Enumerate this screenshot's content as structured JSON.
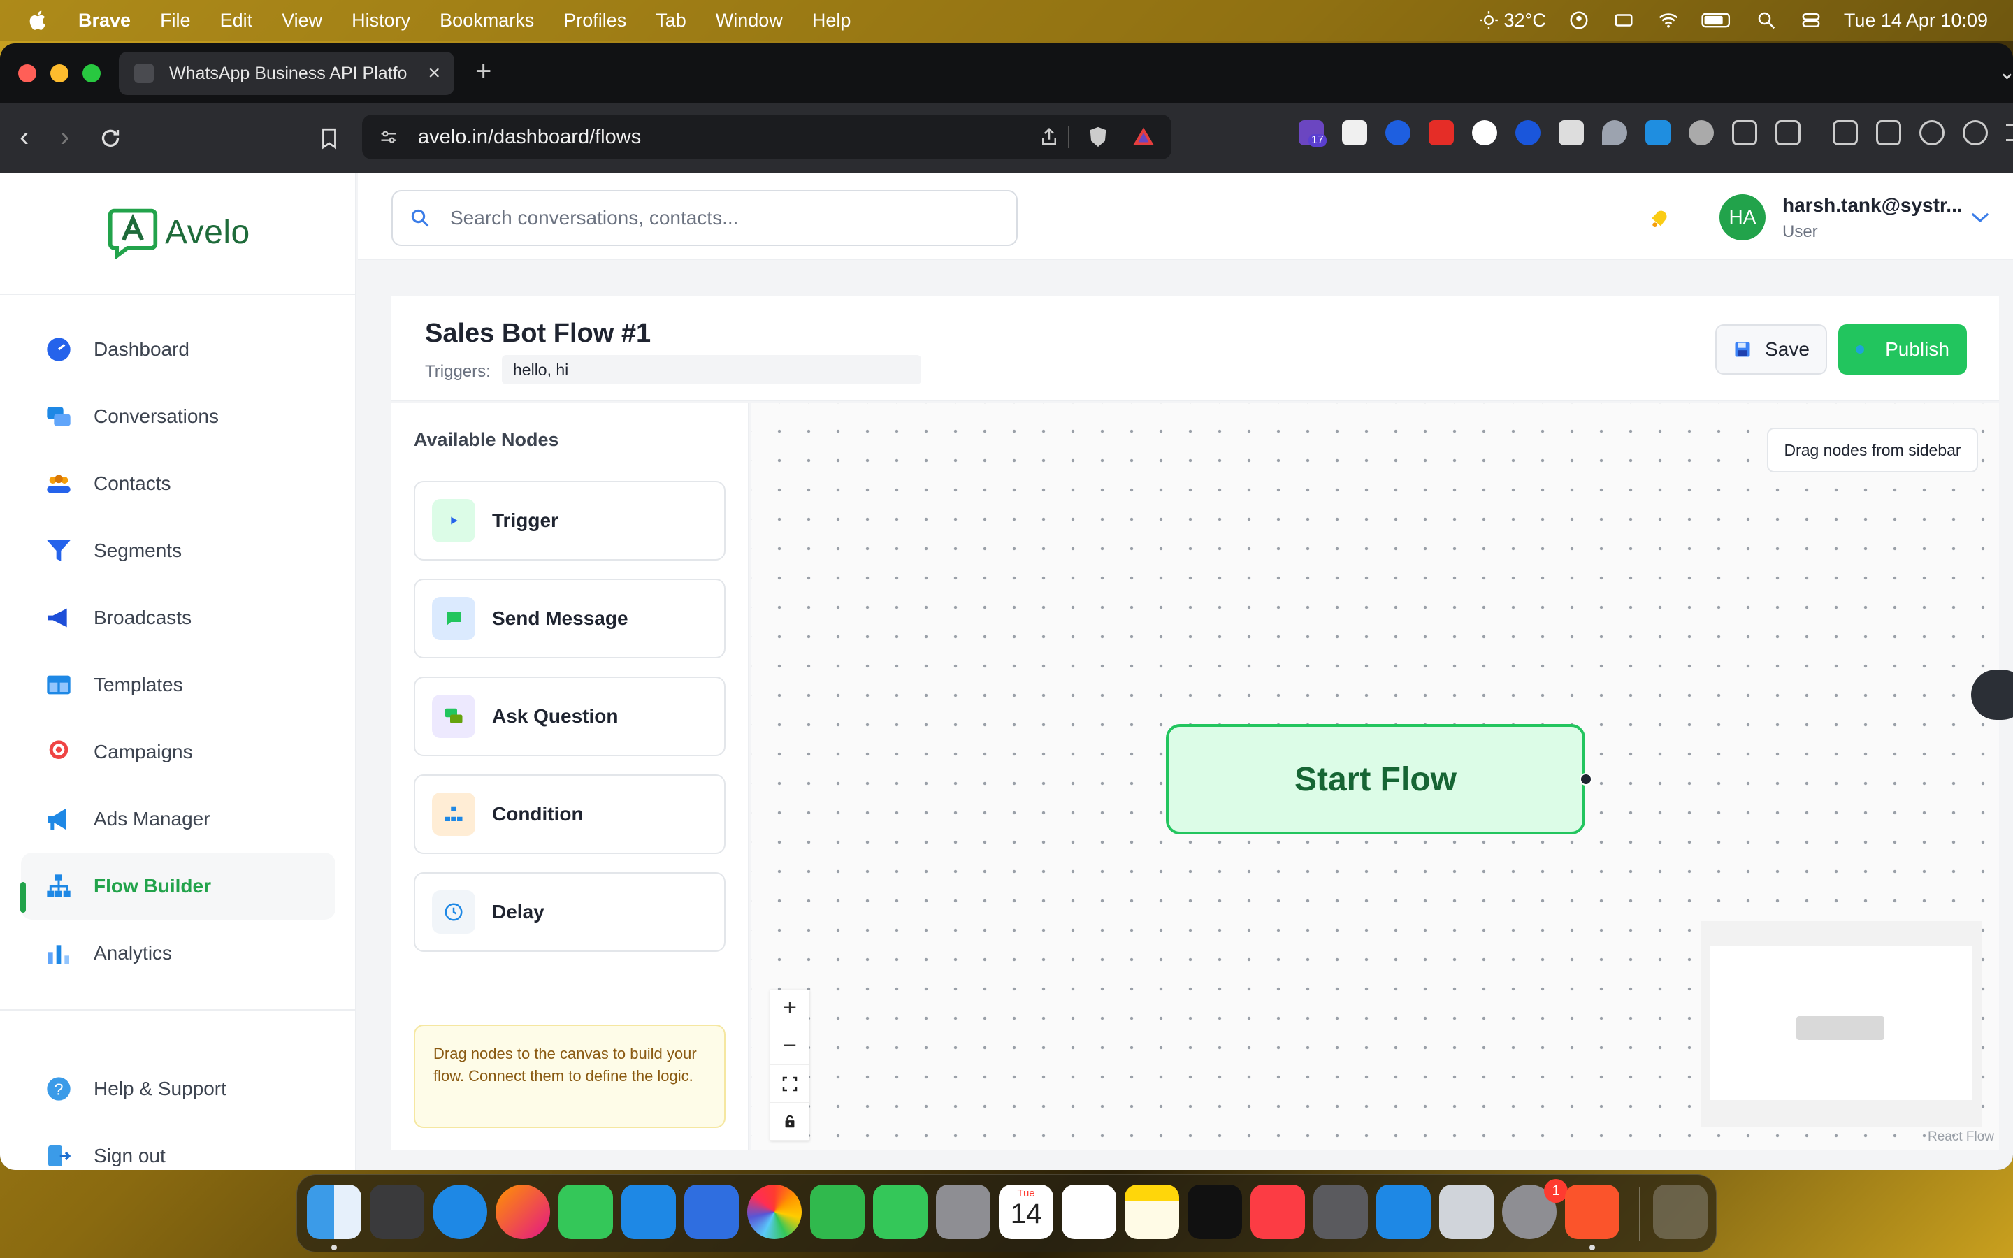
{
  "menubar": {
    "app": "Brave",
    "items": [
      "File",
      "Edit",
      "View",
      "History",
      "Bookmarks",
      "Profiles",
      "Tab",
      "Window",
      "Help"
    ],
    "weather": "32°C",
    "clock": "Tue 14 Apr  10:09"
  },
  "browser": {
    "tab_title": "WhatsApp Business API Platfo",
    "url": "avelo.in/dashboard/flows",
    "ext_badge": "17"
  },
  "app": {
    "logo_text": "Avelo",
    "nav": [
      {
        "label": "Dashboard",
        "icon": "dashboard-icon",
        "color": "#2563eb"
      },
      {
        "label": "Conversations",
        "icon": "chat-bubbles-icon",
        "color": "#1e88e5"
      },
      {
        "label": "Contacts",
        "icon": "people-icon",
        "color": "#f59e0b"
      },
      {
        "label": "Segments",
        "icon": "funnel-icon",
        "color": "#2563eb"
      },
      {
        "label": "Broadcasts",
        "icon": "megaphone-icon",
        "color": "#1d4ed8"
      },
      {
        "label": "Templates",
        "icon": "template-icon",
        "color": "#1e88e5"
      },
      {
        "label": "Campaigns",
        "icon": "target-icon",
        "color": "#ef4444"
      },
      {
        "label": "Ads Manager",
        "icon": "loudspeaker-icon",
        "color": "#1e88e5"
      },
      {
        "label": "Flow Builder",
        "icon": "hierarchy-icon",
        "color": "#1e88e5",
        "active": true
      },
      {
        "label": "Analytics",
        "icon": "bar-chart-icon",
        "color": "#1e88e5"
      }
    ],
    "bottom_nav": [
      {
        "label": "Help & Support",
        "icon": "help-icon"
      },
      {
        "label": "Sign out",
        "icon": "sign-out-icon"
      }
    ],
    "search_placeholder": "Search conversations, contacts...",
    "user": {
      "initials": "HA",
      "name": "harsh.tank@systr...",
      "role": "User"
    }
  },
  "flow": {
    "title": "Sales Bot Flow #1",
    "triggers_label": "Triggers:",
    "triggers_value": "hello, hi",
    "save_label": "Save",
    "publish_label": "Publish",
    "panel_title": "Available Nodes",
    "nodes": [
      {
        "label": "Trigger",
        "icon": "play-icon",
        "bg": "#dcfce7"
      },
      {
        "label": "Send Message",
        "icon": "message-icon",
        "bg": "#dbeafe"
      },
      {
        "label": "Ask Question",
        "icon": "question-chat-icon",
        "bg": "#ede9fe"
      },
      {
        "label": "Condition",
        "icon": "branch-icon",
        "bg": "#ffedd5"
      },
      {
        "label": "Delay",
        "icon": "clock-icon",
        "bg": "#f1f5f9"
      }
    ],
    "hint": "Drag nodes to the canvas to build your flow. Connect them to define the logic.",
    "canvas_note": "Drag nodes from sidebar",
    "start_node": "Start Flow",
    "attribution": "React Flow"
  },
  "dock": {
    "calendar_month": "Tue",
    "calendar_day": "14",
    "settings_badge": "1"
  }
}
